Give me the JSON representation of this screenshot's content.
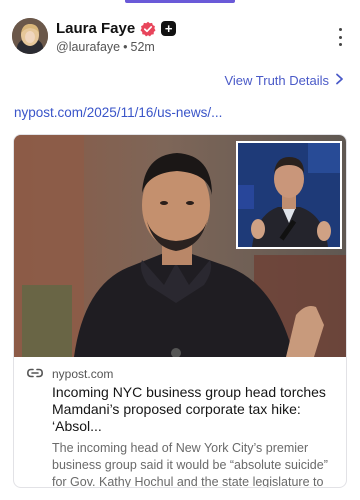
{
  "post": {
    "display_name": "Laura Faye",
    "handle": "@laurafaye",
    "time_ago": "52m",
    "view_details_label": "View Truth Details",
    "link_text": "nypost.com/2025/11/16/us-news/..."
  },
  "card": {
    "source": "nypost.com",
    "title": "Incoming NYC business group head torches Mamdani’s proposed corporate tax hike: ‘Absol...",
    "description": "The incoming head of New York City’s premier business group said it would be “absolute suicide” for Gov. Kathy Hochul and the state legislature to enact Mayor-elect Zohran Mamdani..."
  },
  "icons": {
    "verified": "verified-badge-icon",
    "plus": "plus-icon",
    "more": "more-vertical-icon",
    "chevron": "chevron-right-icon",
    "link": "link-icon"
  },
  "colors": {
    "accent": "#4a5ac8",
    "verified": "#e8455b",
    "link": "#3a55c9"
  }
}
